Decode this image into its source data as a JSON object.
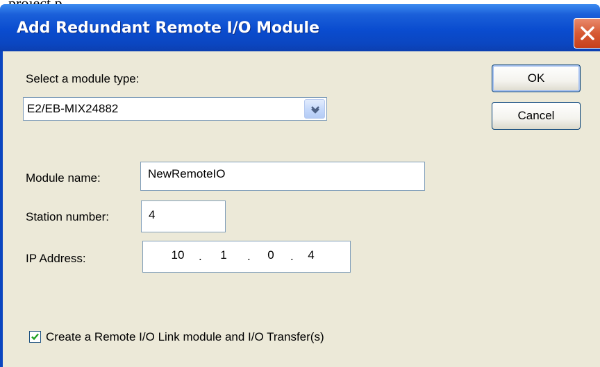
{
  "caption": "project p",
  "window": {
    "title": "Add Redundant Remote I/O Module"
  },
  "module_type": {
    "label": "Select a module type:",
    "value": "E2/EB-MIX24882"
  },
  "buttons": {
    "ok": "OK",
    "cancel": "Cancel"
  },
  "module_name": {
    "label": "Module name:",
    "value": "NewRemoteIO"
  },
  "station_number": {
    "label": "Station number:",
    "value": "4"
  },
  "ip_address": {
    "label": "IP Address:",
    "octets": [
      "10",
      "1",
      "0",
      "4"
    ]
  },
  "create_link": {
    "label": "Create a Remote I/O Link module and I/O Transfer(s)",
    "checked": true
  },
  "icons": {
    "close": "close-icon",
    "dropdown": "chevron-down-icon",
    "check": "check-icon"
  }
}
